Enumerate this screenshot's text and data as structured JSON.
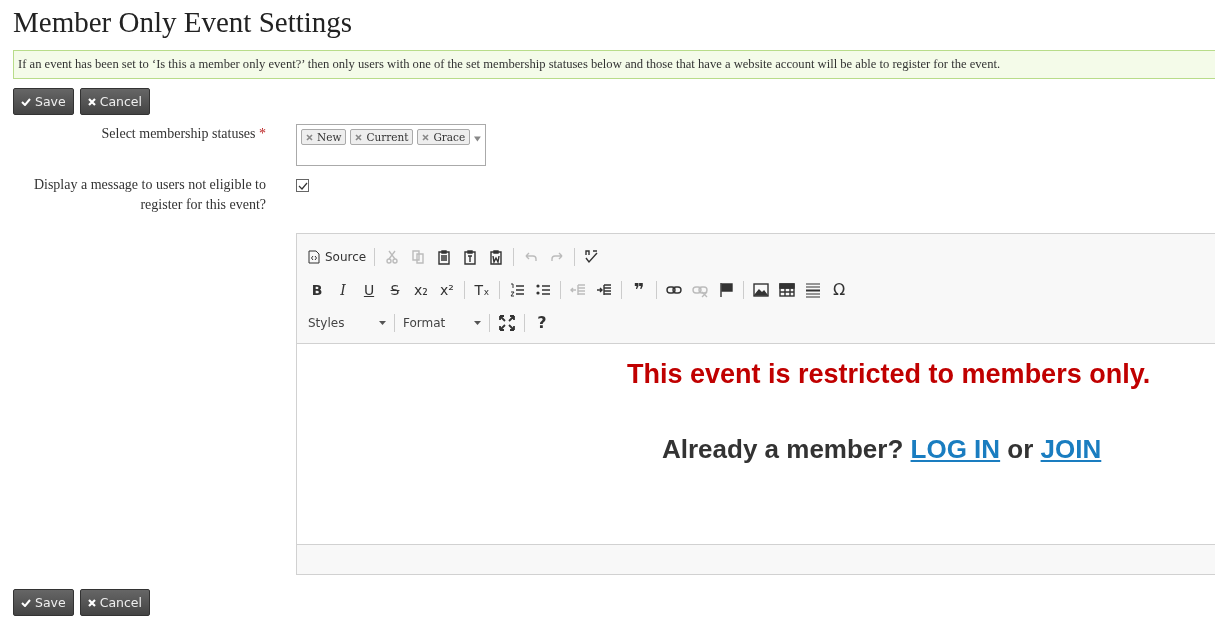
{
  "title": "Member Only Event Settings",
  "info": "If an event has been set to ‘Is this a member only event?’ then only users with one of the set membership statuses below and those that have a website account will be able to register for the event.",
  "top_buttons": [
    {
      "kind": "save",
      "label": "Save"
    },
    {
      "kind": "cancel",
      "label": "Cancel"
    }
  ],
  "statuses_field": {
    "label": "Select membership statuses",
    "required_mark": "*",
    "tags": [
      "New",
      "Current",
      "Grace"
    ]
  },
  "message_field": {
    "label": "Display a message to users not eligible to register for this event?",
    "checked": true
  },
  "editor": {
    "toolbar_rows": [
      [
        [
          {
            "kind": "source",
            "label": "Source",
            "disabled": false
          }
        ],
        [
          {
            "kind": "cut",
            "disabled": true
          },
          {
            "kind": "copy",
            "disabled": true
          },
          {
            "kind": "paste",
            "disabled": false
          },
          {
            "kind": "paste-text",
            "disabled": false
          },
          {
            "kind": "paste-word",
            "disabled": false
          }
        ],
        [
          {
            "kind": "undo",
            "disabled": true
          },
          {
            "kind": "redo",
            "disabled": true
          }
        ],
        [
          {
            "kind": "spellcheck",
            "disabled": false
          }
        ]
      ],
      [
        [
          {
            "kind": "bold",
            "glyph": "B",
            "disabled": false
          },
          {
            "kind": "italic",
            "glyph": "I",
            "disabled": false
          },
          {
            "kind": "underline",
            "glyph": "U",
            "disabled": false
          },
          {
            "kind": "strike",
            "glyph": "S",
            "disabled": false
          },
          {
            "kind": "script",
            "glyph": "x₂",
            "disabled": false
          },
          {
            "kind": "script",
            "glyph": "x²",
            "disabled": false
          }
        ],
        [
          {
            "kind": "remove-format",
            "glyph": "Tₓ",
            "disabled": false
          }
        ],
        [
          {
            "kind": "numbered-list",
            "disabled": false
          },
          {
            "kind": "bulleted-list",
            "disabled": false
          }
        ],
        [
          {
            "kind": "outdent",
            "disabled": true
          },
          {
            "kind": "indent",
            "disabled": false
          }
        ],
        [
          {
            "kind": "quote",
            "glyph": "❞",
            "disabled": false
          }
        ],
        [
          {
            "kind": "link",
            "disabled": false
          },
          {
            "kind": "unlink",
            "disabled": true
          },
          {
            "kind": "flag",
            "disabled": false
          }
        ],
        [
          {
            "kind": "image",
            "disabled": false
          },
          {
            "kind": "table",
            "disabled": false
          },
          {
            "kind": "rule",
            "disabled": false
          },
          {
            "kind": "symbol",
            "glyph": "Ω",
            "disabled": false
          }
        ]
      ],
      [
        [
          {
            "kind": "dropdown",
            "label": "Styles",
            "disabled": false
          }
        ],
        [
          {
            "kind": "dropdown",
            "label": "Format",
            "disabled": false
          }
        ],
        [
          {
            "kind": "maximize",
            "disabled": false
          }
        ],
        [
          {
            "kind": "help",
            "glyph": "?",
            "disabled": false
          }
        ]
      ]
    ],
    "notice": "This event is restricted to members only.",
    "prompt": "Already a member?",
    "link_login": "LOG IN",
    "joiner": "or",
    "link_join": "JOIN"
  },
  "bottom_buttons": [
    {
      "kind": "save",
      "label": "Save"
    },
    {
      "kind": "cancel",
      "label": "Cancel"
    }
  ]
}
